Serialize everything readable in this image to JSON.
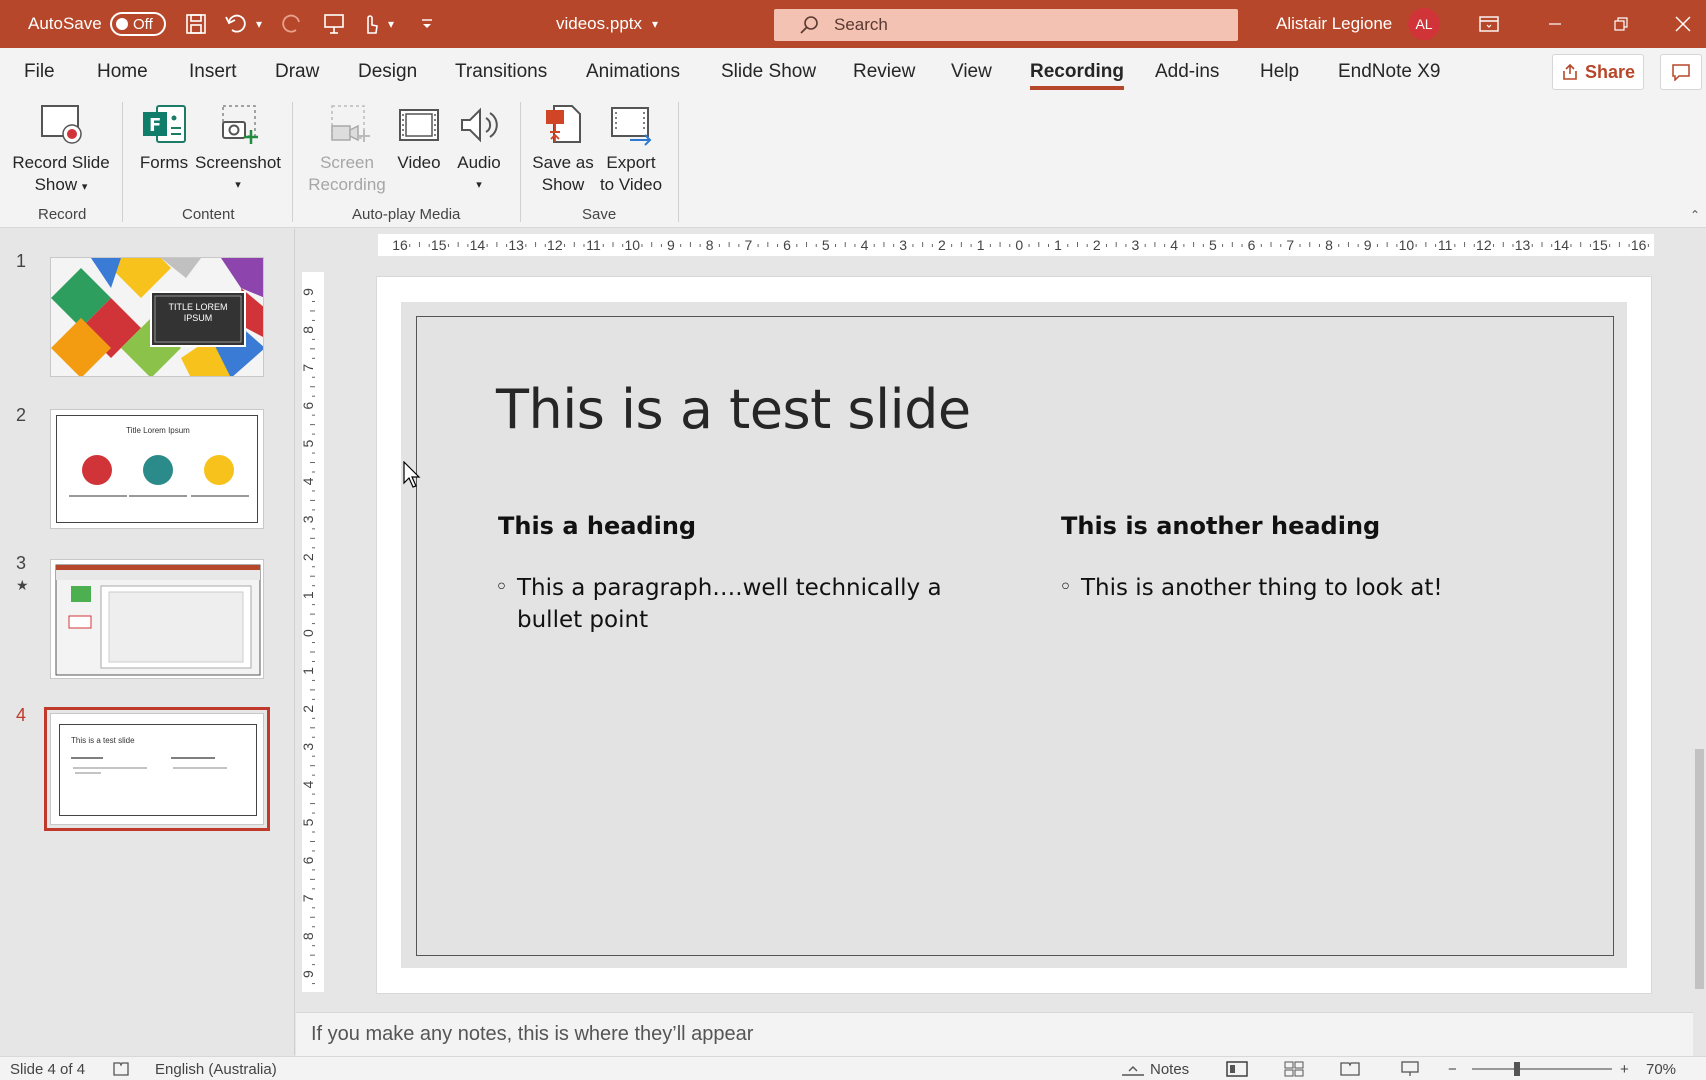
{
  "titlebar": {
    "autosave_label": "AutoSave",
    "autosave_state": "Off",
    "filename": "videos.pptx",
    "search_placeholder": "Search",
    "user_name": "Alistair Legione",
    "user_initials": "AL",
    "accent_color": "#b7472a"
  },
  "tabs": [
    {
      "label": "File"
    },
    {
      "label": "Home"
    },
    {
      "label": "Insert"
    },
    {
      "label": "Draw"
    },
    {
      "label": "Design"
    },
    {
      "label": "Transitions"
    },
    {
      "label": "Animations"
    },
    {
      "label": "Slide Show"
    },
    {
      "label": "Review"
    },
    {
      "label": "View"
    },
    {
      "label": "Recording",
      "active": true
    },
    {
      "label": "Add-ins"
    },
    {
      "label": "Help"
    },
    {
      "label": "EndNote X9"
    }
  ],
  "share_label": "Share",
  "ribbon": {
    "record_slide_show": [
      "Record Slide",
      "Show"
    ],
    "forms": "Forms",
    "screenshot": "Screenshot",
    "screen_recording": [
      "Screen",
      "Recording"
    ],
    "video": "Video",
    "audio": "Audio",
    "save_as_show": [
      "Save as",
      "Show"
    ],
    "export_to_video": [
      "Export",
      "to Video"
    ],
    "groups": {
      "record": "Record",
      "content": "Content",
      "autoplay": "Auto-play Media",
      "save": "Save"
    }
  },
  "thumbnails": [
    {
      "num": "1",
      "title_text": "TITLE LOREM IPSUM"
    },
    {
      "num": "2",
      "title_text": "Title Lorem Ipsum"
    },
    {
      "num": "3"
    },
    {
      "num": "4",
      "title_text": "This is a test slide",
      "selected": true
    }
  ],
  "slide": {
    "title": "This is a test slide",
    "left_heading": "This a heading",
    "left_bullet_line1": "This a paragraph….well technically a",
    "left_bullet_line2": "bullet point",
    "right_heading": "This is another heading",
    "right_bullet": "This is another thing to look at!"
  },
  "notes_placeholder": "If you make any notes, this is where they’ll appear",
  "statusbar": {
    "slide_info": "Slide 4 of 4",
    "language": "English (Australia)",
    "notes_label": "Notes",
    "zoom": "70%"
  },
  "ruler": {
    "horizontal_ticks": [
      "16",
      "15",
      "14",
      "13",
      "12",
      "11",
      "10",
      "9",
      "8",
      "7",
      "6",
      "5",
      "4",
      "3",
      "2",
      "1",
      "0",
      "1",
      "2",
      "3",
      "4",
      "5",
      "6",
      "7",
      "8",
      "9",
      "10",
      "11",
      "12",
      "13",
      "14",
      "15",
      "16"
    ],
    "vertical_ticks": [
      "9",
      "8",
      "7",
      "6",
      "5",
      "4",
      "3",
      "2",
      "1",
      "0",
      "1",
      "2",
      "3",
      "4",
      "5",
      "6",
      "7",
      "8",
      "9"
    ]
  }
}
